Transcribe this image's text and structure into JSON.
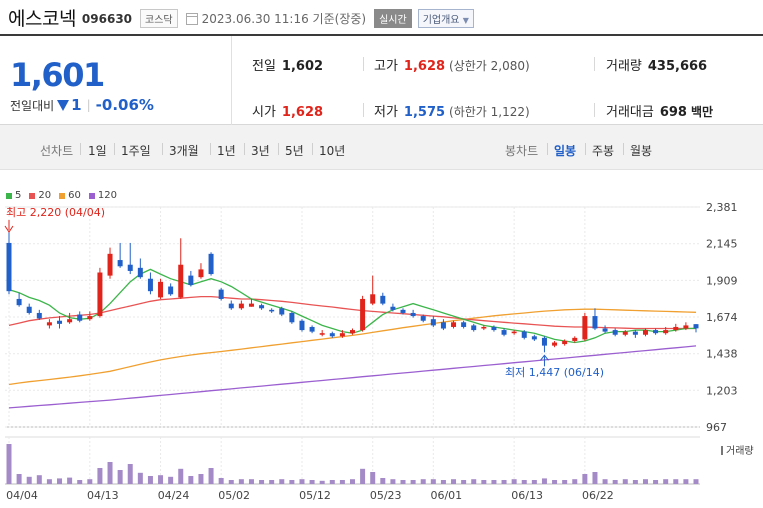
{
  "header": {
    "name": "에스코넥",
    "code": "096630",
    "market": "코스닥",
    "date": "2023.06.30 11:16 기준(장중)",
    "realtime": "실시간",
    "corp": "기업개요"
  },
  "quote": {
    "price": "1,601",
    "change_label": "전일대비",
    "change": "1",
    "change_pct": "-0.06%",
    "prev_label": "전일",
    "prev": "1,602",
    "high_label": "고가",
    "high": "1,628",
    "upper_limit": "(상한가 2,080)",
    "volume_label": "거래량",
    "volume": "435,666",
    "open_label": "시가",
    "open": "1,628",
    "low_label": "저가",
    "low": "1,575",
    "lower_limit": "(하한가 1,122)",
    "amount_label": "거래대금",
    "amount": "698",
    "amount_unit": "백만"
  },
  "tabs": {
    "line": "선차트",
    "periods": [
      "1일",
      "1주일",
      "3개월",
      "1년",
      "3년",
      "5년",
      "10년"
    ],
    "candle": "봉차트",
    "candle_periods": [
      "일봉",
      "주봉",
      "월봉"
    ],
    "active_candle": "일봉"
  },
  "colors": {
    "up": "#e0241b",
    "down": "#2160c8",
    "ma5": "#3cb54a",
    "ma20": "#e85454",
    "ma60": "#f0a030",
    "ma120": "#9b5fd0",
    "volume": "#a48ac6"
  },
  "chart_data": {
    "type": "candlestick",
    "legend": [
      "5",
      "20",
      "60",
      "120"
    ],
    "y_ticks": [
      967,
      1203,
      1438,
      1674,
      1909,
      2145,
      2381
    ],
    "ylim": [
      967,
      2381
    ],
    "x_ticks": [
      "04/04",
      "04/13",
      "04/24",
      "05/02",
      "05/12",
      "05/23",
      "06/01",
      "06/13",
      "06/22"
    ],
    "volume_label": "거래량",
    "max_annotation": "최고 2,220 (04/04)",
    "min_annotation": "최저 1,447 (06/14)",
    "candles": [
      {
        "o": 2150,
        "c": 1840,
        "h": 2220,
        "l": 1820
      },
      {
        "o": 1790,
        "c": 1750,
        "h": 1830,
        "l": 1740
      },
      {
        "o": 1740,
        "c": 1700,
        "h": 1760,
        "l": 1690
      },
      {
        "o": 1700,
        "c": 1665,
        "h": 1720,
        "l": 1655
      },
      {
        "o": 1620,
        "c": 1640,
        "h": 1660,
        "l": 1600
      },
      {
        "o": 1650,
        "c": 1630,
        "h": 1680,
        "l": 1600
      },
      {
        "o": 1640,
        "c": 1660,
        "h": 1700,
        "l": 1630
      },
      {
        "o": 1690,
        "c": 1650,
        "h": 1710,
        "l": 1640
      },
      {
        "o": 1660,
        "c": 1680,
        "h": 1710,
        "l": 1650
      },
      {
        "o": 1680,
        "c": 1960,
        "h": 1990,
        "l": 1670
      },
      {
        "o": 1940,
        "c": 2080,
        "h": 2120,
        "l": 1920
      },
      {
        "o": 2040,
        "c": 2000,
        "h": 2150,
        "l": 1990
      },
      {
        "o": 2010,
        "c": 1970,
        "h": 2150,
        "l": 1950
      },
      {
        "o": 1990,
        "c": 1930,
        "h": 2050,
        "l": 1920
      },
      {
        "o": 1920,
        "c": 1840,
        "h": 1960,
        "l": 1820
      },
      {
        "o": 1800,
        "c": 1900,
        "h": 1920,
        "l": 1790
      },
      {
        "o": 1870,
        "c": 1820,
        "h": 1890,
        "l": 1810
      },
      {
        "o": 1800,
        "c": 2010,
        "h": 2180,
        "l": 1790
      },
      {
        "o": 1940,
        "c": 1880,
        "h": 1970,
        "l": 1870
      },
      {
        "o": 1930,
        "c": 1980,
        "h": 2020,
        "l": 1920
      },
      {
        "o": 2080,
        "c": 1950,
        "h": 2090,
        "l": 1940
      },
      {
        "o": 1850,
        "c": 1790,
        "h": 1860,
        "l": 1780
      },
      {
        "o": 1760,
        "c": 1730,
        "h": 1780,
        "l": 1720
      },
      {
        "o": 1730,
        "c": 1760,
        "h": 1780,
        "l": 1720
      },
      {
        "o": 1740,
        "c": 1760,
        "h": 1790,
        "l": 1740
      },
      {
        "o": 1750,
        "c": 1730,
        "h": 1760,
        "l": 1720
      },
      {
        "o": 1720,
        "c": 1710,
        "h": 1730,
        "l": 1700
      },
      {
        "o": 1730,
        "c": 1690,
        "h": 1740,
        "l": 1680
      },
      {
        "o": 1700,
        "c": 1640,
        "h": 1710,
        "l": 1630
      },
      {
        "o": 1650,
        "c": 1590,
        "h": 1660,
        "l": 1580
      },
      {
        "o": 1610,
        "c": 1580,
        "h": 1620,
        "l": 1570
      },
      {
        "o": 1560,
        "c": 1570,
        "h": 1590,
        "l": 1550
      },
      {
        "o": 1570,
        "c": 1550,
        "h": 1580,
        "l": 1540
      },
      {
        "o": 1550,
        "c": 1570,
        "h": 1590,
        "l": 1540
      },
      {
        "o": 1570,
        "c": 1590,
        "h": 1600,
        "l": 1560
      },
      {
        "o": 1590,
        "c": 1790,
        "h": 1810,
        "l": 1580
      },
      {
        "o": 1760,
        "c": 1820,
        "h": 1940,
        "l": 1750
      },
      {
        "o": 1810,
        "c": 1760,
        "h": 1830,
        "l": 1750
      },
      {
        "o": 1740,
        "c": 1720,
        "h": 1760,
        "l": 1710
      },
      {
        "o": 1720,
        "c": 1700,
        "h": 1730,
        "l": 1690
      },
      {
        "o": 1700,
        "c": 1680,
        "h": 1720,
        "l": 1670
      },
      {
        "o": 1680,
        "c": 1650,
        "h": 1690,
        "l": 1640
      },
      {
        "o": 1660,
        "c": 1620,
        "h": 1680,
        "l": 1610
      },
      {
        "o": 1640,
        "c": 1600,
        "h": 1660,
        "l": 1590
      },
      {
        "o": 1610,
        "c": 1640,
        "h": 1650,
        "l": 1600
      },
      {
        "o": 1640,
        "c": 1610,
        "h": 1650,
        "l": 1600
      },
      {
        "o": 1620,
        "c": 1590,
        "h": 1630,
        "l": 1580
      },
      {
        "o": 1600,
        "c": 1610,
        "h": 1620,
        "l": 1590
      },
      {
        "o": 1610,
        "c": 1590,
        "h": 1620,
        "l": 1580
      },
      {
        "o": 1590,
        "c": 1560,
        "h": 1600,
        "l": 1550
      },
      {
        "o": 1570,
        "c": 1580,
        "h": 1590,
        "l": 1560
      },
      {
        "o": 1580,
        "c": 1540,
        "h": 1590,
        "l": 1530
      },
      {
        "o": 1550,
        "c": 1530,
        "h": 1560,
        "l": 1520
      },
      {
        "o": 1540,
        "c": 1490,
        "h": 1550,
        "l": 1447
      },
      {
        "o": 1490,
        "c": 1510,
        "h": 1520,
        "l": 1480
      },
      {
        "o": 1500,
        "c": 1520,
        "h": 1530,
        "l": 1490
      },
      {
        "o": 1520,
        "c": 1540,
        "h": 1550,
        "l": 1510
      },
      {
        "o": 1530,
        "c": 1680,
        "h": 1700,
        "l": 1520
      },
      {
        "o": 1680,
        "c": 1600,
        "h": 1730,
        "l": 1590
      },
      {
        "o": 1600,
        "c": 1580,
        "h": 1620,
        "l": 1570
      },
      {
        "o": 1590,
        "c": 1560,
        "h": 1600,
        "l": 1550
      },
      {
        "o": 1560,
        "c": 1580,
        "h": 1590,
        "l": 1550
      },
      {
        "o": 1580,
        "c": 1560,
        "h": 1590,
        "l": 1540
      },
      {
        "o": 1560,
        "c": 1590,
        "h": 1600,
        "l": 1550
      },
      {
        "o": 1590,
        "c": 1570,
        "h": 1600,
        "l": 1560
      },
      {
        "o": 1570,
        "c": 1590,
        "h": 1610,
        "l": 1560
      },
      {
        "o": 1590,
        "c": 1610,
        "h": 1630,
        "l": 1580
      },
      {
        "o": 1600,
        "c": 1620,
        "h": 1640,
        "l": 1590
      },
      {
        "o": 1628,
        "c": 1601,
        "h": 1628,
        "l": 1575
      }
    ],
    "ma5": [
      1850,
      1830,
      1800,
      1780,
      1750,
      1700,
      1670,
      1660,
      1665,
      1700,
      1760,
      1830,
      1900,
      1950,
      1980,
      1950,
      1920,
      1900,
      1880,
      1900,
      1920,
      1900,
      1870,
      1830,
      1790,
      1770,
      1750,
      1730,
      1710,
      1680,
      1650,
      1620,
      1600,
      1580,
      1570,
      1590,
      1640,
      1690,
      1720,
      1740,
      1760,
      1740,
      1720,
      1700,
      1680,
      1660,
      1640,
      1620,
      1610,
      1600,
      1590,
      1580,
      1570,
      1550,
      1530,
      1520,
      1510,
      1520,
      1540,
      1570,
      1580,
      1580,
      1590,
      1590,
      1580,
      1580,
      1590,
      1600,
      1601
    ],
    "ma20": [
      1620,
      1635,
      1650,
      1660,
      1668,
      1674,
      1680,
      1685,
      1690,
      1700,
      1715,
      1730,
      1745,
      1760,
      1775,
      1785,
      1790,
      1795,
      1800,
      1805,
      1805,
      1800,
      1795,
      1790,
      1790,
      1785,
      1780,
      1775,
      1768,
      1760,
      1752,
      1745,
      1738,
      1730,
      1722,
      1715,
      1710,
      1705,
      1700,
      1695,
      1690,
      1685,
      1680,
      1675,
      1668,
      1662,
      1656,
      1650,
      1645,
      1640,
      1635,
      1630,
      1625,
      1620,
      1615,
      1612,
      1610,
      1610,
      1608,
      1606,
      1604,
      1602,
      1600,
      1600,
      1600,
      1600,
      1600,
      1600,
      1600
    ],
    "ma60": [
      1240,
      1250,
      1258,
      1265,
      1272,
      1280,
      1288,
      1296,
      1305,
      1315,
      1325,
      1340,
      1355,
      1370,
      1385,
      1398,
      1410,
      1420,
      1430,
      1438,
      1445,
      1452,
      1460,
      1468,
      1476,
      1484,
      1492,
      1500,
      1508,
      1516,
      1524,
      1532,
      1540,
      1548,
      1556,
      1565,
      1575,
      1585,
      1595,
      1605,
      1614,
      1623,
      1632,
      1641,
      1650,
      1658,
      1666,
      1674,
      1682,
      1688,
      1694,
      1700,
      1706,
      1712,
      1716,
      1720,
      1722,
      1724,
      1724,
      1722,
      1720,
      1718,
      1716,
      1714,
      1712,
      1710,
      1708,
      1706,
      1704
    ],
    "ma120": [
      1090,
      1095,
      1100,
      1105,
      1110,
      1115,
      1120,
      1125,
      1130,
      1135,
      1140,
      1146,
      1152,
      1158,
      1164,
      1170,
      1176,
      1182,
      1188,
      1194,
      1200,
      1206,
      1212,
      1218,
      1224,
      1230,
      1236,
      1242,
      1248,
      1254,
      1260,
      1266,
      1272,
      1278,
      1284,
      1290,
      1296,
      1302,
      1308,
      1314,
      1320,
      1326,
      1332,
      1338,
      1344,
      1350,
      1356,
      1362,
      1368,
      1374,
      1380,
      1386,
      1392,
      1398,
      1404,
      1410,
      1416,
      1422,
      1428,
      1434,
      1440,
      1446,
      1452,
      1458,
      1464,
      1470,
      1476,
      1482,
      1488
    ],
    "volumes": [
      100,
      25,
      18,
      22,
      12,
      14,
      16,
      10,
      12,
      40,
      55,
      35,
      50,
      28,
      20,
      22,
      18,
      38,
      20,
      25,
      40,
      15,
      10,
      12,
      12,
      10,
      10,
      12,
      10,
      12,
      10,
      8,
      10,
      10,
      12,
      38,
      30,
      15,
      12,
      10,
      10,
      12,
      12,
      10,
      12,
      10,
      12,
      10,
      10,
      10,
      12,
      10,
      10,
      14,
      10,
      10,
      12,
      25,
      30,
      12,
      10,
      12,
      10,
      12,
      10,
      12,
      12,
      12,
      12
    ]
  }
}
